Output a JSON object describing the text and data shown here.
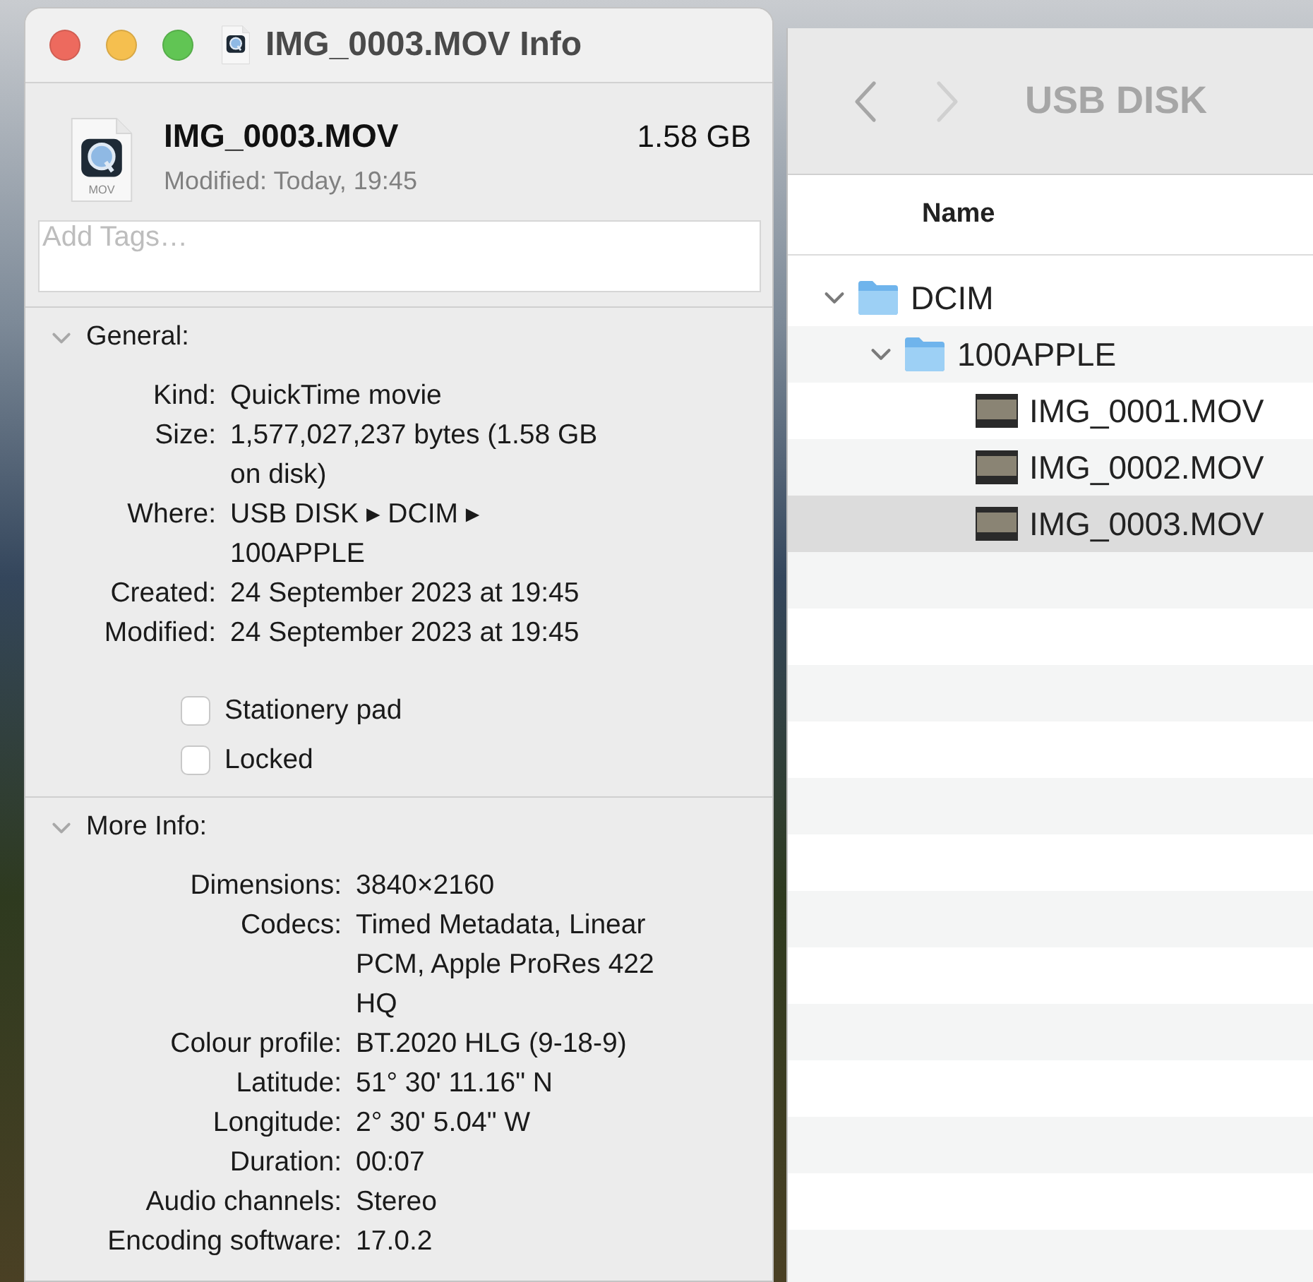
{
  "info_window": {
    "title": "IMG_0003.MOV Info",
    "file": {
      "name": "IMG_0003.MOV",
      "size": "1.58 GB",
      "modified": "Modified: Today, 19:45",
      "icon_label": "MOV"
    },
    "tags": {
      "placeholder": "Add Tags…"
    },
    "sections": [
      {
        "title": "General:",
        "expanded": true,
        "rows": [
          {
            "label": "Kind:",
            "value": "QuickTime movie"
          },
          {
            "label": "Size:",
            "value": "1,577,027,237 bytes (1.58 GB on disk)"
          },
          {
            "label": "Where:",
            "value": "USB DISK ▸ DCIM ▸ 100APPLE"
          },
          {
            "label": "Created:",
            "value": "24 September 2023 at 19:45"
          },
          {
            "label": "Modified:",
            "value": "24 September 2023 at 19:45"
          }
        ],
        "checkboxes": [
          {
            "label": "Stationery pad",
            "checked": false
          },
          {
            "label": "Locked",
            "checked": false
          }
        ]
      },
      {
        "title": "More Info:",
        "expanded": true,
        "rows": [
          {
            "label": "Dimensions:",
            "value": "3840×2160"
          },
          {
            "label": "Codecs:",
            "value": "Timed Metadata, Linear PCM, Apple ProRes 422 HQ"
          },
          {
            "label": "Colour profile:",
            "value": "BT.2020 HLG (9-18-9)"
          },
          {
            "label": "Latitude:",
            "value": "51° 30' 11.16\" N"
          },
          {
            "label": "Longitude:",
            "value": "2° 30' 5.04\" W"
          },
          {
            "label": "Duration:",
            "value": "00:07"
          },
          {
            "label": "Audio channels:",
            "value": "Stereo"
          },
          {
            "label": "Encoding software:",
            "value": "17.0.2"
          }
        ]
      }
    ]
  },
  "finder": {
    "title": "USB DISK",
    "columns": [
      "Name"
    ],
    "tree": [
      {
        "name": "DCIM",
        "kind": "folder",
        "expanded": true,
        "selected": false,
        "children": [
          {
            "name": "100APPLE",
            "kind": "folder",
            "expanded": true,
            "selected": false,
            "children": [
              {
                "name": "IMG_0001.MOV",
                "kind": "movie",
                "selected": false
              },
              {
                "name": "IMG_0002.MOV",
                "kind": "movie",
                "selected": false
              },
              {
                "name": "IMG_0003.MOV",
                "kind": "movie",
                "selected": true
              }
            ]
          }
        ]
      }
    ]
  }
}
